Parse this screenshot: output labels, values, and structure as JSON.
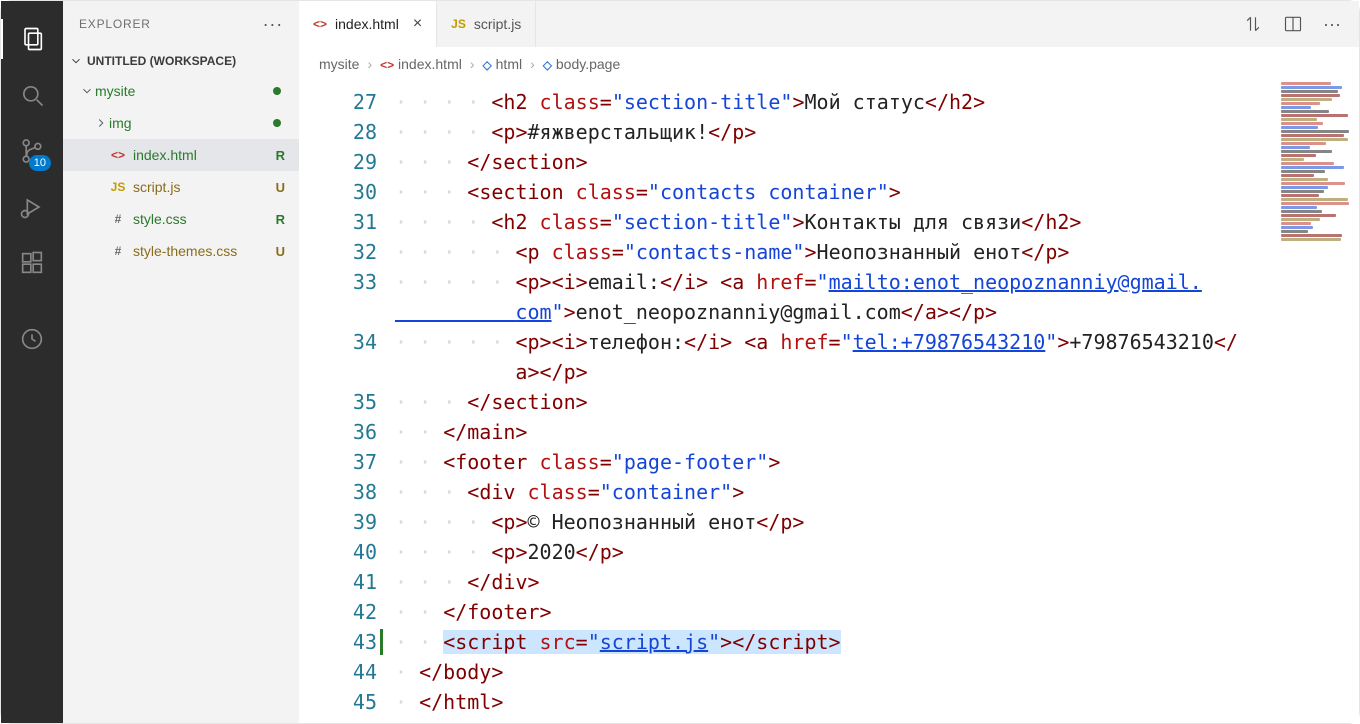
{
  "activity": {
    "scm_badge": "10"
  },
  "sidebar": {
    "title": "EXPLORER",
    "root": "UNTITLED (WORKSPACE)",
    "items": [
      {
        "label": "mysite",
        "kind": "folder",
        "expanded": true,
        "status": "dot"
      },
      {
        "label": "img",
        "kind": "folder",
        "expanded": false,
        "status": "dot",
        "indent": 1
      },
      {
        "label": "index.html",
        "kind": "file",
        "icon": "html",
        "status": "R",
        "selected": true,
        "indent": 1
      },
      {
        "label": "script.js",
        "kind": "file",
        "icon": "js",
        "status": "U",
        "indent": 1
      },
      {
        "label": "style.css",
        "kind": "file",
        "icon": "hash",
        "status": "R",
        "indent": 1
      },
      {
        "label": "style-themes.css",
        "kind": "file",
        "icon": "hash",
        "status": "U",
        "indent": 1
      }
    ]
  },
  "tabs": [
    {
      "label": "index.html",
      "icon": "html",
      "active": true
    },
    {
      "label": "script.js",
      "icon": "js",
      "active": false
    }
  ],
  "breadcrumbs": [
    {
      "label": "mysite",
      "icon": ""
    },
    {
      "label": "index.html",
      "icon": "html"
    },
    {
      "label": "html",
      "icon": "cube"
    },
    {
      "label": "body.page",
      "icon": "cube"
    }
  ],
  "code": {
    "first_line": 27,
    "lines": [
      {
        "n": 27,
        "guides": 4,
        "tokens": [
          [
            "tag",
            "<h2 "
          ],
          [
            "attr",
            "class"
          ],
          [
            "tag",
            "="
          ],
          [
            "str",
            "\"section-title\""
          ],
          [
            "tag",
            ">"
          ],
          [
            "text",
            "Мой статус"
          ],
          [
            "tag",
            "</h2>"
          ]
        ]
      },
      {
        "n": 28,
        "guides": 4,
        "tokens": [
          [
            "tag",
            "<p>"
          ],
          [
            "text",
            "#яжверстальщик!"
          ],
          [
            "tag",
            "</p>"
          ]
        ]
      },
      {
        "n": 29,
        "guides": 3,
        "tokens": [
          [
            "tag",
            "</section>"
          ]
        ]
      },
      {
        "n": 30,
        "guides": 3,
        "tokens": [
          [
            "tag",
            "<section "
          ],
          [
            "attr",
            "class"
          ],
          [
            "tag",
            "="
          ],
          [
            "str",
            "\"contacts container\""
          ],
          [
            "tag",
            ">"
          ]
        ]
      },
      {
        "n": 31,
        "guides": 4,
        "tokens": [
          [
            "tag",
            "<h2 "
          ],
          [
            "attr",
            "class"
          ],
          [
            "tag",
            "="
          ],
          [
            "str",
            "\"section-title\""
          ],
          [
            "tag",
            ">"
          ],
          [
            "text",
            "Контакты для связи"
          ],
          [
            "tag",
            "</h2>"
          ]
        ]
      },
      {
        "n": 32,
        "guides": 5,
        "tokens": [
          [
            "tag",
            "<p "
          ],
          [
            "attr",
            "class"
          ],
          [
            "tag",
            "="
          ],
          [
            "str",
            "\"contacts-name\""
          ],
          [
            "tag",
            ">"
          ],
          [
            "text",
            "Неопознанный енот"
          ],
          [
            "tag",
            "</p>"
          ]
        ]
      },
      {
        "n": 33,
        "guides": 5,
        "wrap": true,
        "tokens": [
          [
            "tag",
            "<p><i>"
          ],
          [
            "text",
            "email:"
          ],
          [
            "tag",
            "</i> <a "
          ],
          [
            "attr",
            "href"
          ],
          [
            "tag",
            "="
          ],
          [
            "str",
            "\""
          ],
          [
            "link",
            "mailto:enot_neopoznanniy@gmail.\n          com"
          ],
          [
            "str",
            "\""
          ],
          [
            "tag",
            ">"
          ],
          [
            "text",
            "enot_neopoznanniy@gmail.com"
          ],
          [
            "tag",
            "</a></p>"
          ]
        ]
      },
      {
        "n": 34,
        "guides": 5,
        "wrap": true,
        "tokens": [
          [
            "tag",
            "<p><i>"
          ],
          [
            "text",
            "телефон:"
          ],
          [
            "tag",
            "</i> <a "
          ],
          [
            "attr",
            "href"
          ],
          [
            "tag",
            "="
          ],
          [
            "str",
            "\""
          ],
          [
            "link",
            "tel:+79876543210"
          ],
          [
            "str",
            "\""
          ],
          [
            "tag",
            ">"
          ],
          [
            "text",
            "+79876543210"
          ],
          [
            "tag",
            "</\n          a></p>"
          ]
        ]
      },
      {
        "n": 35,
        "guides": 3,
        "tokens": [
          [
            "tag",
            "</section>"
          ]
        ]
      },
      {
        "n": 36,
        "guides": 2,
        "tokens": [
          [
            "tag",
            "</main>"
          ]
        ]
      },
      {
        "n": 37,
        "guides": 2,
        "tokens": [
          [
            "tag",
            "<footer "
          ],
          [
            "attr",
            "class"
          ],
          [
            "tag",
            "="
          ],
          [
            "str",
            "\"page-footer\""
          ],
          [
            "tag",
            ">"
          ]
        ]
      },
      {
        "n": 38,
        "guides": 3,
        "tokens": [
          [
            "tag",
            "<div "
          ],
          [
            "attr",
            "class"
          ],
          [
            "tag",
            "="
          ],
          [
            "str",
            "\"container\""
          ],
          [
            "tag",
            ">"
          ]
        ]
      },
      {
        "n": 39,
        "guides": 4,
        "tokens": [
          [
            "tag",
            "<p>"
          ],
          [
            "text",
            "© Неопознанный енот"
          ],
          [
            "tag",
            "</p>"
          ]
        ]
      },
      {
        "n": 40,
        "guides": 4,
        "tokens": [
          [
            "tag",
            "<p>"
          ],
          [
            "text",
            "2020"
          ],
          [
            "tag",
            "</p>"
          ]
        ]
      },
      {
        "n": 41,
        "guides": 3,
        "tokens": [
          [
            "tag",
            "</div>"
          ]
        ]
      },
      {
        "n": 42,
        "guides": 2,
        "tokens": [
          [
            "tag",
            "</footer>"
          ]
        ]
      },
      {
        "n": 43,
        "guides": 2,
        "mod": true,
        "sel": true,
        "tokens": [
          [
            "tag",
            "<script "
          ],
          [
            "attr",
            "src"
          ],
          [
            "tag",
            "="
          ],
          [
            "str",
            "\""
          ],
          [
            "link",
            "script.js"
          ],
          [
            "str",
            "\""
          ],
          [
            "tag",
            ">"
          ],
          [
            "tag",
            "</script>"
          ]
        ]
      },
      {
        "n": 44,
        "guides": 1,
        "tokens": [
          [
            "tag",
            "</body>"
          ]
        ]
      },
      {
        "n": 45,
        "guides": 1,
        "tokens": [
          [
            "tag",
            "</html>"
          ]
        ]
      }
    ]
  }
}
